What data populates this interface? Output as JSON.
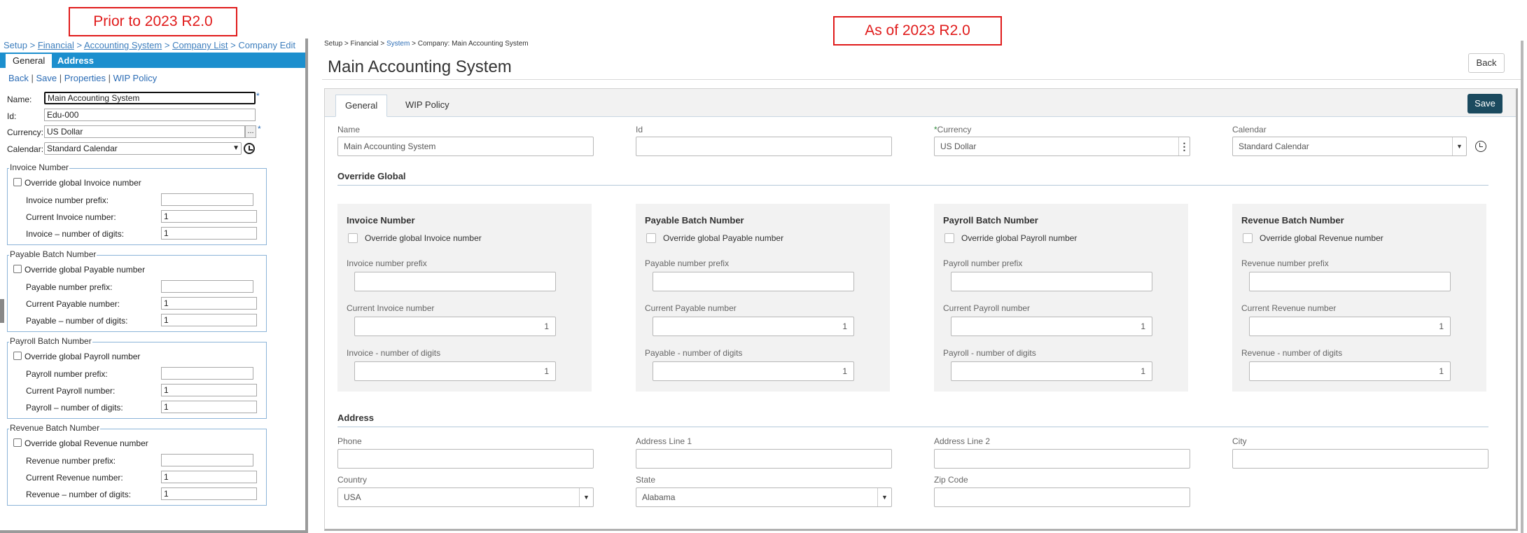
{
  "callouts": {
    "old": "Prior to 2023 R2.0",
    "new": "As of 2023 R2.0"
  },
  "old": {
    "breadcrumb": {
      "setup": "Setup",
      "financial": "Financial",
      "accounting_system": "Accounting System",
      "company_list": "Company List",
      "company_edit": "Company Edit",
      "sep": " > "
    },
    "tabs": {
      "general": "General",
      "address": "Address"
    },
    "links": {
      "back": "Back",
      "save": "Save",
      "properties": "Properties",
      "wip_policy": "WIP Policy",
      "sep": " | "
    },
    "fields": {
      "name_label": "Name:",
      "name_value": "Main Accounting System",
      "id_label": "Id:",
      "id_value": "Edu-000",
      "currency_label": "Currency:",
      "currency_value": "US Dollar",
      "calendar_label": "Calendar:",
      "calendar_value": "Standard Calendar",
      "required_mark": "*",
      "ellipsis": "..."
    },
    "groups": [
      {
        "legend": "Invoice Number",
        "override": "Override global Invoice number",
        "prefix": "Invoice number prefix:",
        "current": "Current Invoice number:",
        "current_value": "1",
        "digits": "Invoice – number of digits:",
        "digits_value": "1"
      },
      {
        "legend": "Payable Batch Number",
        "override": "Override global Payable number",
        "prefix": "Payable number prefix:",
        "current": "Current Payable number:",
        "current_value": "1",
        "digits": "Payable – number of digits:",
        "digits_value": "1"
      },
      {
        "legend": "Payroll Batch Number",
        "override": "Override global Payroll number",
        "prefix": "Payroll number prefix:",
        "current": "Current Payroll number:",
        "current_value": "1",
        "digits": "Payroll – number of digits:",
        "digits_value": "1"
      },
      {
        "legend": "Revenue Batch Number",
        "override": "Override global Revenue number",
        "prefix": "Revenue number prefix:",
        "current": "Current Revenue number:",
        "current_value": "1",
        "digits": "Revenue – number of digits:",
        "digits_value": "1"
      }
    ]
  },
  "new": {
    "breadcrumb": {
      "setup": "Setup",
      "financial": "Financial",
      "system": "System",
      "company": "Company: Main Accounting System",
      "sep": " > "
    },
    "title": "Main Accounting System",
    "back_label": "Back",
    "save_label": "Save",
    "tabs": {
      "general": "General",
      "wip_policy": "WIP Policy"
    },
    "fields": {
      "name_label": "Name",
      "name_value": "Main Accounting System",
      "id_label": "Id",
      "id_value": "",
      "currency_label": "Currency",
      "currency_value": "US Dollar",
      "required_mark": "*",
      "calendar_label": "Calendar",
      "calendar_value": "Standard Calendar"
    },
    "override_global_heading": "Override Global",
    "cards": [
      {
        "title": "Invoice Number",
        "override": "Override global Invoice number",
        "prefix": "Invoice number prefix",
        "current": "Current Invoice number",
        "current_value": "1",
        "digits": "Invoice - number of digits",
        "digits_value": "1"
      },
      {
        "title": "Payable Batch Number",
        "override": "Override global Payable number",
        "prefix": "Payable number prefix",
        "current": "Current Payable number",
        "current_value": "1",
        "digits": "Payable - number of digits",
        "digits_value": "1"
      },
      {
        "title": "Payroll Batch Number",
        "override": "Override global Payroll number",
        "prefix": "Payroll number prefix",
        "current": "Current Payroll number",
        "current_value": "1",
        "digits": "Payroll - number of digits",
        "digits_value": "1"
      },
      {
        "title": "Revenue Batch Number",
        "override": "Override global Revenue number",
        "prefix": "Revenue number prefix",
        "current": "Current Revenue number",
        "current_value": "1",
        "digits": "Revenue - number of digits",
        "digits_value": "1"
      }
    ],
    "address": {
      "heading": "Address",
      "phone_label": "Phone",
      "line1_label": "Address Line 1",
      "line2_label": "Address Line 2",
      "city_label": "City",
      "country_label": "Country",
      "country_value": "USA",
      "state_label": "State",
      "state_value": "Alabama",
      "zip_label": "Zip Code"
    }
  },
  "colors": {
    "callout_red": "#e01b1b",
    "old_tab_blue": "#1c8fce",
    "new_save_dark_teal": "#1b4a5f",
    "link_blue": "#2b6cb5"
  },
  "icons": [
    "history-icon",
    "chevron-down-icon",
    "kebab-menu-icon",
    "ellipsis-icon"
  ]
}
